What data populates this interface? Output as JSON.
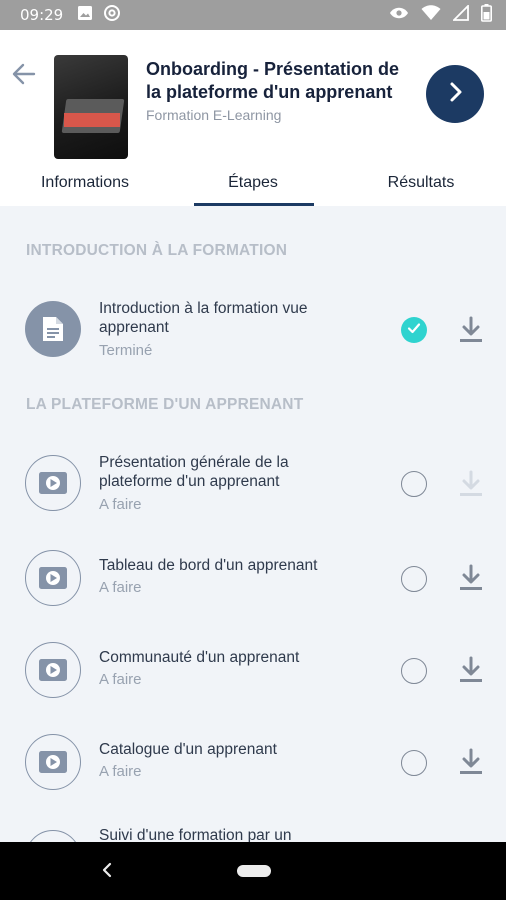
{
  "status_bar": {
    "time": "09:29",
    "left_icons": [
      "image-icon",
      "at-icon"
    ],
    "right_icons": [
      "eye-icon",
      "wifi-icon",
      "signal-icon",
      "battery-icon"
    ]
  },
  "header": {
    "course_title": "Onboarding - Présentation de la plateforme d'un apprenant",
    "course_subtitle": "Formation E-Learning",
    "thumbnail_icon": "laptop-image"
  },
  "tabs": [
    {
      "label": "Informations",
      "active": false
    },
    {
      "label": "Étapes",
      "active": true
    },
    {
      "label": "Résultats",
      "active": false
    }
  ],
  "sections": [
    {
      "title": "INTRODUCTION À LA FORMATION",
      "steps": [
        {
          "title": "Introduction à la formation vue apprenant",
          "status": "Terminé",
          "type": "document",
          "done": true,
          "downloadable": true
        }
      ]
    },
    {
      "title": "LA PLATEFORME D'UN APPRENANT",
      "steps": [
        {
          "title": "Présentation générale de la plateforme d'un apprenant",
          "status": "A faire",
          "type": "video",
          "done": false,
          "downloadable": false
        },
        {
          "title": "Tableau de bord d'un apprenant",
          "status": "A faire",
          "type": "video",
          "done": false,
          "downloadable": true
        },
        {
          "title": "Communauté d'un apprenant",
          "status": "A faire",
          "type": "video",
          "done": false,
          "downloadable": true
        },
        {
          "title": "Catalogue d'un apprenant",
          "status": "A faire",
          "type": "video",
          "done": false,
          "downloadable": true
        },
        {
          "title": "Suivi d'une formation par un",
          "status": "",
          "type": "video",
          "done": false,
          "downloadable": true
        }
      ]
    }
  ],
  "colors": {
    "primary": "#1c3a63",
    "check_done": "#2fd3cf",
    "section_title": "#b7bec8",
    "icon_grey": "#8593a8",
    "download_active": "#7f8896",
    "download_disabled": "#d4dae2"
  }
}
